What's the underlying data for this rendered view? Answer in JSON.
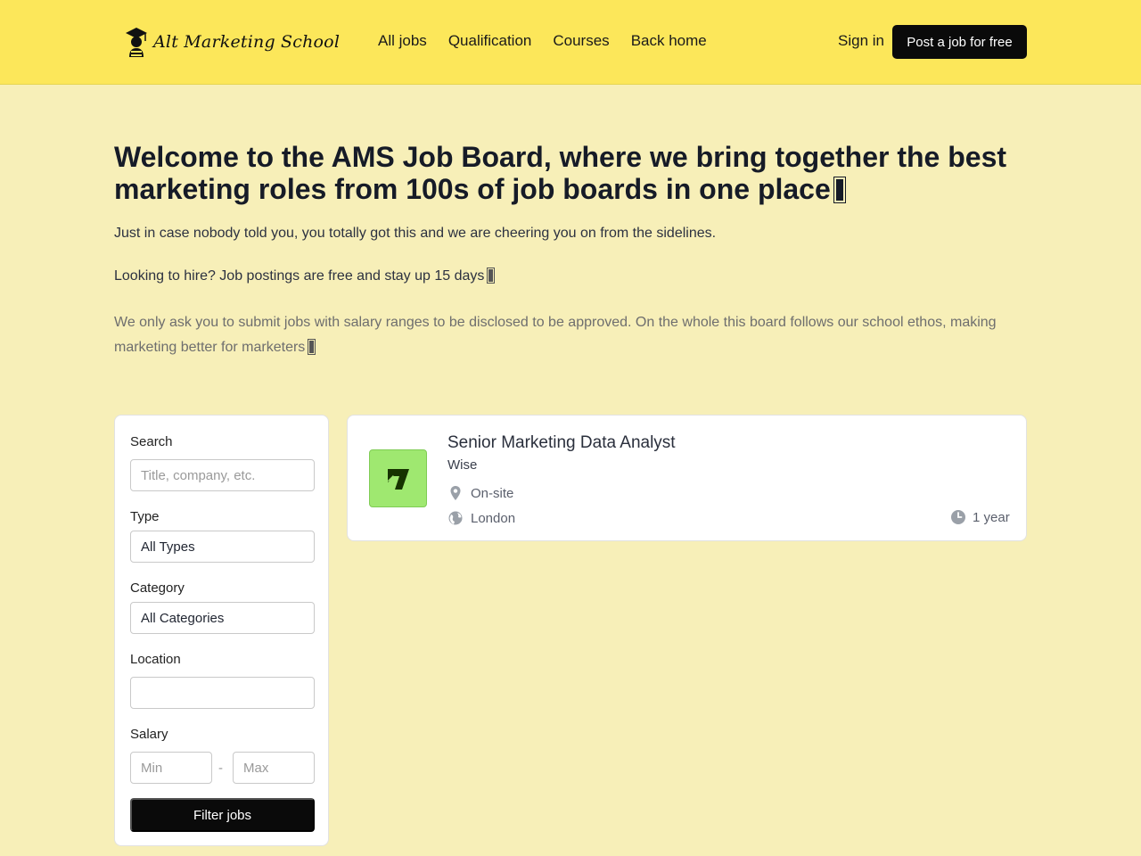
{
  "header": {
    "logo_text": "Alt Marketing School",
    "nav": [
      {
        "label": "All jobs"
      },
      {
        "label": "Qualification"
      },
      {
        "label": "Courses"
      },
      {
        "label": "Back home"
      }
    ],
    "signin_label": "Sign in",
    "post_job_label": "Post a job for free"
  },
  "hero": {
    "title": "Welcome to the AMS Job Board, where we bring together the best marketing roles from 100s of job boards in one place",
    "p1": "Just in case nobody told you, you totally got this and we are cheering you on from the sidelines.",
    "p2": "Looking to hire? Job postings are free and stay up 15 days",
    "p3": "We only ask you to submit jobs with salary ranges to be disclosed to be approved. On the whole this board follows our school ethos, making marketing better for marketers"
  },
  "filters": {
    "search_label": "Search",
    "search_placeholder": "Title, company, etc.",
    "type_label": "Type",
    "type_value": "All Types",
    "category_label": "Category",
    "category_value": "All Categories",
    "location_label": "Location",
    "location_value": "",
    "salary_label": "Salary",
    "salary_min_placeholder": "Min",
    "salary_separator": "-",
    "salary_max_placeholder": "Max",
    "filter_button": "Filter jobs"
  },
  "jobs": [
    {
      "title": "Senior Marketing Data Analyst",
      "company": "Wise",
      "workplace": "On-site",
      "location": "London",
      "age": "1 year",
      "logo_icon": "wise-logo",
      "logo_bg": "#9fe870"
    }
  ],
  "colors": {
    "header_bg": "#fce75a",
    "page_bg": "#f7efb8",
    "button_bg": "#0a0a0a"
  }
}
